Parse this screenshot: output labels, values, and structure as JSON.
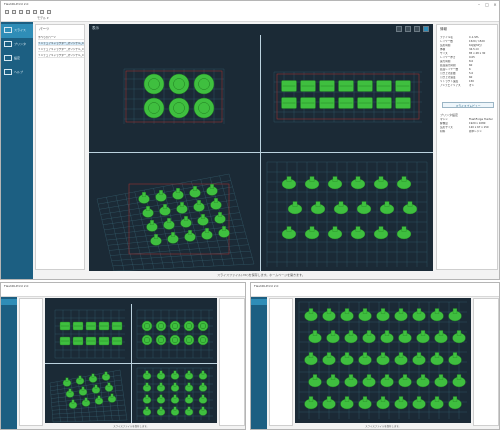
{
  "main": {
    "title": "FlashDLPrint 2.0",
    "win_buttons": [
      "–",
      "□",
      "×"
    ],
    "model_tab": "モデル ▾",
    "sidebar": [
      {
        "label": "スライス",
        "icon": "printer-icon"
      },
      {
        "label": "プリンタ",
        "icon": "printer-icon"
      },
      {
        "label": "設定",
        "icon": "settings-icon"
      },
      {
        "label": "ヘルプ",
        "icon": "help-icon"
      }
    ],
    "list_title": "パーツ",
    "list_items": [
      "すべてのパーツ",
      "ミニチュアキャラクター_オリジナル_C - 1.stl",
      "ミニチュアキャラクター_オリジナル_C - 2.stl",
      "ミニチュアキャラクター_オリジナル_C - 3.stl"
    ],
    "viewport_label": "表示",
    "props_title": "情報",
    "props": [
      {
        "k": "ファイル名",
        "v": "C-1.STL"
      },
      {
        "k": "レイヤー数",
        "v": "1520 / 1520"
      },
      {
        "k": "造形時間",
        "v": "1時間32分"
      },
      {
        "k": "体積",
        "v": "34.5 ml"
      },
      {
        "k": "サイズ",
        "v": "85 x 48 x 30"
      },
      {
        "k": "レイヤー厚さ",
        "v": "0.05"
      },
      {
        "k": "露光時間",
        "v": "8.0"
      },
      {
        "k": "底面露光時間",
        "v": "60"
      },
      {
        "k": "底面レイヤー数",
        "v": "6"
      },
      {
        "k": "引き上げ距離",
        "v": "5.0"
      },
      {
        "k": "引き上げ速度",
        "v": "60"
      },
      {
        "k": "リトラクト速度",
        "v": "150"
      },
      {
        "k": "アンチエイリアス",
        "v": "オン"
      }
    ],
    "props_button": "スライスプレビュー",
    "props_section2": "プリンタ設定",
    "props2": [
      {
        "k": "マシン",
        "v": "FlashForge Hunter"
      },
      {
        "k": "解像度",
        "v": "1920 x 1080"
      },
      {
        "k": "造形サイズ",
        "v": "120 x 67 x 150"
      },
      {
        "k": "材料",
        "v": "標準レジン"
      }
    ],
    "status": "スライスファイル(.fdr)を保存します。ホームページを開きます。"
  },
  "small_left": {
    "title": "FlashDLPrint 2.0",
    "status": "スライスファイルを保存します。"
  },
  "small_right": {
    "title": "FlashDLPrint 2.0",
    "status": "スライスファイルを保存します。"
  },
  "colors": {
    "sidebar": "#1c5f82",
    "sidebar_selected": "#2f8db7",
    "viewport": "#1b2a36",
    "model": "#3fbf3f",
    "grid": "#3a6a78",
    "bbox": "#b03030"
  }
}
